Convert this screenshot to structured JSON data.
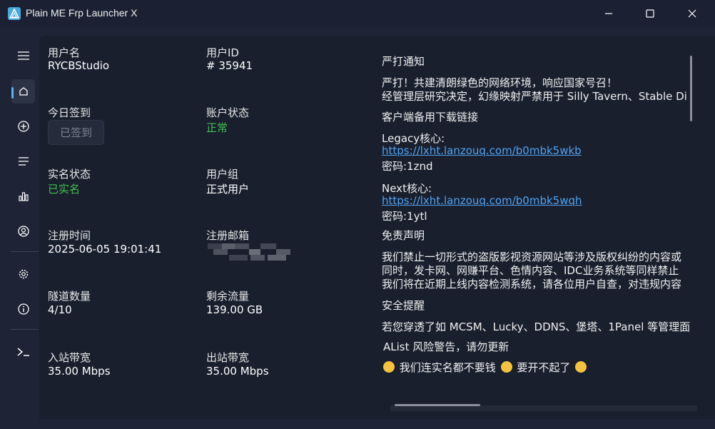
{
  "window": {
    "title": "Plain ME Frp Launcher X"
  },
  "nav": {
    "menu_icon": "hamburger-icon",
    "items": [
      {
        "icon": "home-icon",
        "active": true
      },
      {
        "icon": "add-circle-icon",
        "active": false
      },
      {
        "icon": "list-icon",
        "active": false
      },
      {
        "icon": "bar-chart-icon",
        "active": false
      },
      {
        "icon": "user-circle-icon",
        "active": false
      },
      {
        "icon": "gear-icon",
        "active": false
      },
      {
        "icon": "info-icon",
        "active": false
      },
      {
        "icon": "terminal-icon",
        "active": false
      }
    ]
  },
  "user": {
    "username_label": "用户名",
    "username": "RYCBStudio",
    "userid_label": "用户ID",
    "userid": "# 35941",
    "signin_label": "今日签到",
    "signin_button": "已签到",
    "account_status_label": "账户状态",
    "account_status": "正常",
    "realname_label": "实名状态",
    "realname_status": "已实名",
    "group_label": "用户组",
    "group": "正式用户",
    "register_time_label": "注册时间",
    "register_time": "2025-06-05 19:01:41",
    "email_label": "注册邮箱",
    "tunnels_label": "隧道数量",
    "tunnels": "4/10",
    "traffic_label": "剩余流量",
    "traffic": "139.00 GB",
    "inbound_label": "入站带宽",
    "inbound": "35.00 Mbps",
    "outbound_label": "出站带宽",
    "outbound": "35.00 Mbps"
  },
  "notice": {
    "heading1": "严打通知",
    "line1": "严打！共建清朗绿色的网络环境，响应国家号召！",
    "line2": "经管理层研究决定，幻缘映射严禁用于 Silly Tavern、Stable Di",
    "heading2": "客户端备用下载链接",
    "legacy_label": "Legacy核心:",
    "legacy_link": "https://lxht.lanzouq.com/b0mbk5wkb",
    "legacy_pwd": "密码:1znd",
    "next_label": "Next核心:",
    "next_link": "https://lxht.lanzouq.com/b0mbk5wqh",
    "next_pwd": "密码:1ytl",
    "heading3": "免责声明",
    "disc1": "我们禁止一切形式的盗版影视资源网站等涉及版权纠纷的内容或",
    "disc2": "同时，发卡网、网赚平台、色情内容、IDC业务系统等同样禁止",
    "disc3": "我们将在近期上线内容检测系统，请各位用户自查，对违规内容",
    "heading4": "安全提醒",
    "sec1": "若您穿透了如 MCSM、Lucky、DDNS、堡塔、1Panel 等管理面",
    "sec2": "AList 风险警告，请勿更新",
    "sec3": "我们连实名都不要钱",
    "sec3b": "要开不起了"
  }
}
